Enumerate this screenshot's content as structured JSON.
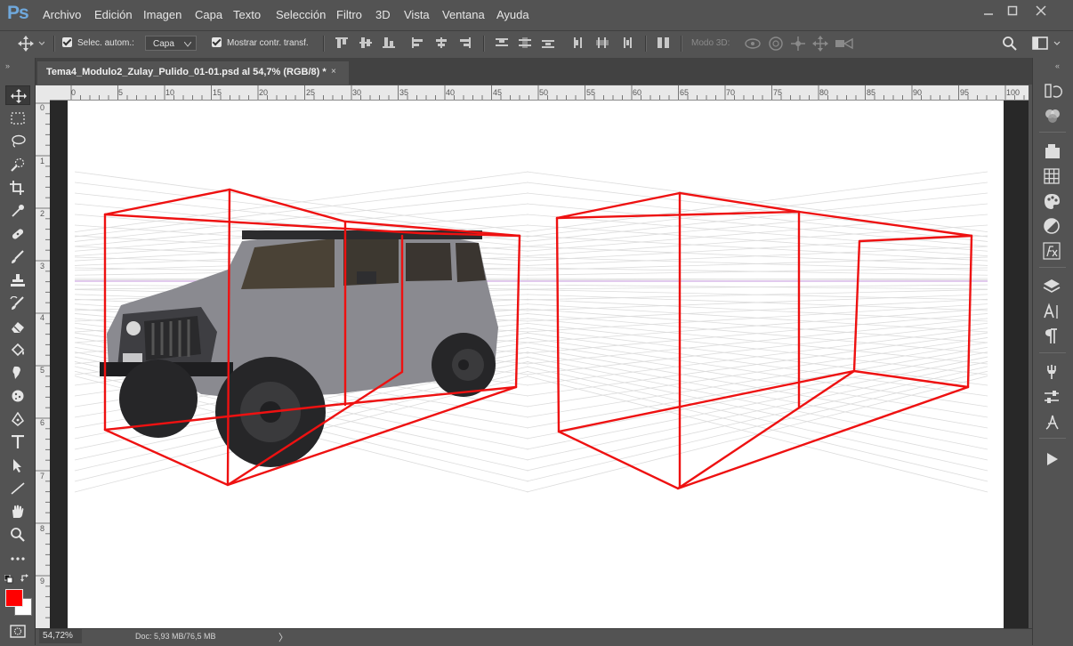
{
  "app": {
    "logo": "Ps"
  },
  "menu": [
    "Archivo",
    "Edición",
    "Imagen",
    "Capa",
    "Texto",
    "Selección",
    "Filtro",
    "3D",
    "Vista",
    "Ventana",
    "Ayuda"
  ],
  "options": {
    "auto_select_label": "Selec. autom.:",
    "auto_select_value": "Capa",
    "show_transform_label": "Mostrar contr. transf.",
    "mode3d_label": "Modo 3D:"
  },
  "document": {
    "tab_title": "Tema4_Modulo2_Zulay_Pulido_01-01.psd al 54,7% (RGB/8) *",
    "close_glyph": "×"
  },
  "ruler_top": [
    "0",
    "5",
    "10",
    "15",
    "20",
    "25",
    "30",
    "35",
    "40",
    "45",
    "50",
    "55",
    "60",
    "65",
    "70",
    "75",
    "80",
    "85",
    "90",
    "95",
    "100"
  ],
  "ruler_left": [
    "0",
    "1",
    "2",
    "3",
    "4",
    "5",
    "6",
    "7",
    "8",
    "9"
  ],
  "status": {
    "zoom": "54,72%",
    "doc_info": "Doc: 5,93 MB/76,5 MB",
    "arrow": "〉"
  },
  "colors": {
    "foreground": "#ff0000",
    "background": "#ffffff",
    "accent": "#6fa8dc",
    "wireframe": "#ee1111"
  }
}
